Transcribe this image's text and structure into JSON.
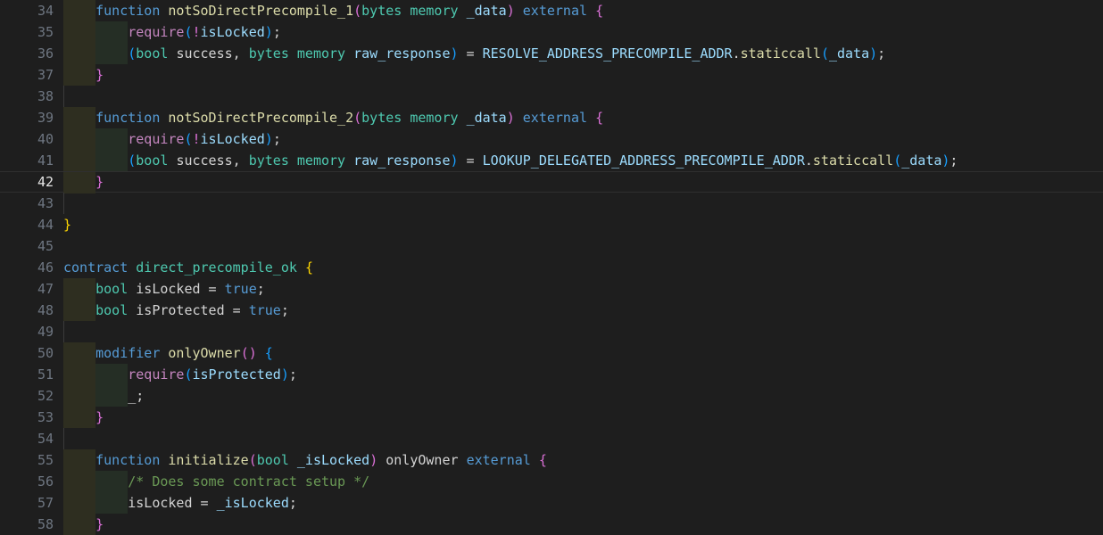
{
  "editor": {
    "language": "solidity",
    "active_line": 42,
    "first_line": 34,
    "last_line": 58,
    "colors": {
      "background": "#1e1e1e",
      "gutter_text": "#6e7681",
      "gutter_active_text": "#e6e6e6",
      "active_line_border": "#2f2f2f",
      "indent_olive": "#2e2e20",
      "indent_green": "#252e25",
      "indent_guide": "#3b3b3b",
      "keyword": "#569cd6",
      "type": "#4ec9b0",
      "function_name": "#dcdcaa",
      "variable": "#9cdcfe",
      "punctuation": "#d4d4d4",
      "comment": "#6a9955",
      "require_keyword": "#c586c0",
      "bracket_level_1": "#ffd700",
      "bracket_level_2": "#da70d6",
      "bracket_level_3": "#179fff"
    }
  },
  "lines": [
    {
      "number": "34",
      "indents": [
        {
          "level": 1,
          "style": "olive"
        }
      ],
      "tokens": [
        {
          "t": "    ",
          "c": "plain"
        },
        {
          "t": "function",
          "c": "kw"
        },
        {
          "t": " ",
          "c": "plain"
        },
        {
          "t": "notSoDirectPrecompile_1",
          "c": "fn"
        },
        {
          "t": "(",
          "c": "b2"
        },
        {
          "t": "bytes",
          "c": "typ"
        },
        {
          "t": " ",
          "c": "plain"
        },
        {
          "t": "memory",
          "c": "typ"
        },
        {
          "t": " ",
          "c": "plain"
        },
        {
          "t": "_data",
          "c": "var"
        },
        {
          "t": ")",
          "c": "b2"
        },
        {
          "t": " ",
          "c": "plain"
        },
        {
          "t": "external",
          "c": "kw"
        },
        {
          "t": " ",
          "c": "plain"
        },
        {
          "t": "{",
          "c": "b2"
        }
      ]
    },
    {
      "number": "35",
      "indents": [
        {
          "level": 1,
          "style": "olive"
        },
        {
          "level": 2,
          "style": "green"
        }
      ],
      "tokens": [
        {
          "t": "        ",
          "c": "plain"
        },
        {
          "t": "require",
          "c": "req"
        },
        {
          "t": "(",
          "c": "b3"
        },
        {
          "t": "!",
          "c": "b2"
        },
        {
          "t": "isLocked",
          "c": "var"
        },
        {
          "t": ")",
          "c": "b3"
        },
        {
          "t": ";",
          "c": "punc"
        }
      ]
    },
    {
      "number": "36",
      "indents": [
        {
          "level": 1,
          "style": "olive"
        },
        {
          "level": 2,
          "style": "green"
        }
      ],
      "tokens": [
        {
          "t": "        ",
          "c": "plain"
        },
        {
          "t": "(",
          "c": "b3"
        },
        {
          "t": "bool",
          "c": "typ"
        },
        {
          "t": " ",
          "c": "plain"
        },
        {
          "t": "success",
          "c": "plain"
        },
        {
          "t": ", ",
          "c": "punc"
        },
        {
          "t": "bytes",
          "c": "typ"
        },
        {
          "t": " ",
          "c": "plain"
        },
        {
          "t": "memory",
          "c": "typ"
        },
        {
          "t": " ",
          "c": "plain"
        },
        {
          "t": "raw_response",
          "c": "var"
        },
        {
          "t": ")",
          "c": "b3"
        },
        {
          "t": " = ",
          "c": "punc"
        },
        {
          "t": "RESOLVE_ADDRESS_PRECOMPILE_ADDR",
          "c": "var"
        },
        {
          "t": ".",
          "c": "punc"
        },
        {
          "t": "staticcall",
          "c": "fn"
        },
        {
          "t": "(",
          "c": "b3"
        },
        {
          "t": "_data",
          "c": "var"
        },
        {
          "t": ")",
          "c": "b3"
        },
        {
          "t": ";",
          "c": "punc"
        }
      ]
    },
    {
      "number": "37",
      "indents": [
        {
          "level": 1,
          "style": "olive"
        }
      ],
      "tokens": [
        {
          "t": "    ",
          "c": "plain"
        },
        {
          "t": "}",
          "c": "b2"
        }
      ]
    },
    {
      "number": "38",
      "indents": [
        {
          "level": 1,
          "style": "line"
        }
      ],
      "tokens": []
    },
    {
      "number": "39",
      "indents": [
        {
          "level": 1,
          "style": "olive"
        }
      ],
      "tokens": [
        {
          "t": "    ",
          "c": "plain"
        },
        {
          "t": "function",
          "c": "kw"
        },
        {
          "t": " ",
          "c": "plain"
        },
        {
          "t": "notSoDirectPrecompile_2",
          "c": "fn"
        },
        {
          "t": "(",
          "c": "b2"
        },
        {
          "t": "bytes",
          "c": "typ"
        },
        {
          "t": " ",
          "c": "plain"
        },
        {
          "t": "memory",
          "c": "typ"
        },
        {
          "t": " ",
          "c": "plain"
        },
        {
          "t": "_data",
          "c": "var"
        },
        {
          "t": ")",
          "c": "b2"
        },
        {
          "t": " ",
          "c": "plain"
        },
        {
          "t": "external",
          "c": "kw"
        },
        {
          "t": " ",
          "c": "plain"
        },
        {
          "t": "{",
          "c": "b2"
        }
      ]
    },
    {
      "number": "40",
      "indents": [
        {
          "level": 1,
          "style": "olive"
        },
        {
          "level": 2,
          "style": "green"
        }
      ],
      "tokens": [
        {
          "t": "        ",
          "c": "plain"
        },
        {
          "t": "require",
          "c": "req"
        },
        {
          "t": "(",
          "c": "b3"
        },
        {
          "t": "!",
          "c": "b2"
        },
        {
          "t": "isLocked",
          "c": "var"
        },
        {
          "t": ")",
          "c": "b3"
        },
        {
          "t": ";",
          "c": "punc"
        }
      ]
    },
    {
      "number": "41",
      "indents": [
        {
          "level": 1,
          "style": "olive"
        },
        {
          "level": 2,
          "style": "green"
        }
      ],
      "tokens": [
        {
          "t": "        ",
          "c": "plain"
        },
        {
          "t": "(",
          "c": "b3"
        },
        {
          "t": "bool",
          "c": "typ"
        },
        {
          "t": " ",
          "c": "plain"
        },
        {
          "t": "success",
          "c": "plain"
        },
        {
          "t": ", ",
          "c": "punc"
        },
        {
          "t": "bytes",
          "c": "typ"
        },
        {
          "t": " ",
          "c": "plain"
        },
        {
          "t": "memory",
          "c": "typ"
        },
        {
          "t": " ",
          "c": "plain"
        },
        {
          "t": "raw_response",
          "c": "var"
        },
        {
          "t": ")",
          "c": "b3"
        },
        {
          "t": " = ",
          "c": "punc"
        },
        {
          "t": "LOOKUP_DELEGATED_ADDRESS_PRECOMPILE_ADDR",
          "c": "var"
        },
        {
          "t": ".",
          "c": "punc"
        },
        {
          "t": "staticcall",
          "c": "fn"
        },
        {
          "t": "(",
          "c": "b3"
        },
        {
          "t": "_data",
          "c": "var"
        },
        {
          "t": ")",
          "c": "b3"
        },
        {
          "t": ";",
          "c": "punc"
        }
      ]
    },
    {
      "number": "42",
      "active": true,
      "indents": [
        {
          "level": 1,
          "style": "olive"
        }
      ],
      "tokens": [
        {
          "t": "    ",
          "c": "plain"
        },
        {
          "t": "}",
          "c": "b2"
        }
      ]
    },
    {
      "number": "43",
      "indents": [
        {
          "level": 1,
          "style": "line"
        }
      ],
      "tokens": []
    },
    {
      "number": "44",
      "indents": [],
      "tokens": [
        {
          "t": "}",
          "c": "b1"
        }
      ]
    },
    {
      "number": "45",
      "indents": [],
      "tokens": []
    },
    {
      "number": "46",
      "indents": [],
      "tokens": [
        {
          "t": "contract",
          "c": "kw"
        },
        {
          "t": " ",
          "c": "plain"
        },
        {
          "t": "direct_precompile_ok",
          "c": "typ"
        },
        {
          "t": " ",
          "c": "plain"
        },
        {
          "t": "{",
          "c": "b1"
        }
      ]
    },
    {
      "number": "47",
      "indents": [
        {
          "level": 1,
          "style": "olive"
        }
      ],
      "tokens": [
        {
          "t": "    ",
          "c": "plain"
        },
        {
          "t": "bool",
          "c": "typ"
        },
        {
          "t": " ",
          "c": "plain"
        },
        {
          "t": "isLocked",
          "c": "plain"
        },
        {
          "t": " = ",
          "c": "punc"
        },
        {
          "t": "true",
          "c": "kw"
        },
        {
          "t": ";",
          "c": "punc"
        }
      ]
    },
    {
      "number": "48",
      "indents": [
        {
          "level": 1,
          "style": "olive"
        }
      ],
      "tokens": [
        {
          "t": "    ",
          "c": "plain"
        },
        {
          "t": "bool",
          "c": "typ"
        },
        {
          "t": " ",
          "c": "plain"
        },
        {
          "t": "isProtected",
          "c": "plain"
        },
        {
          "t": " = ",
          "c": "punc"
        },
        {
          "t": "true",
          "c": "kw"
        },
        {
          "t": ";",
          "c": "punc"
        }
      ]
    },
    {
      "number": "49",
      "indents": [
        {
          "level": 1,
          "style": "line"
        }
      ],
      "tokens": []
    },
    {
      "number": "50",
      "indents": [
        {
          "level": 1,
          "style": "olive"
        }
      ],
      "tokens": [
        {
          "t": "    ",
          "c": "plain"
        },
        {
          "t": "modifier",
          "c": "kw"
        },
        {
          "t": " ",
          "c": "plain"
        },
        {
          "t": "onlyOwner",
          "c": "fn"
        },
        {
          "t": "()",
          "c": "b2"
        },
        {
          "t": " ",
          "c": "plain"
        },
        {
          "t": "{",
          "c": "b3"
        }
      ]
    },
    {
      "number": "51",
      "indents": [
        {
          "level": 1,
          "style": "olive"
        },
        {
          "level": 2,
          "style": "green"
        }
      ],
      "tokens": [
        {
          "t": "        ",
          "c": "plain"
        },
        {
          "t": "require",
          "c": "req"
        },
        {
          "t": "(",
          "c": "b3"
        },
        {
          "t": "isProtected",
          "c": "var"
        },
        {
          "t": ")",
          "c": "b3"
        },
        {
          "t": ";",
          "c": "punc"
        }
      ]
    },
    {
      "number": "52",
      "indents": [
        {
          "level": 1,
          "style": "olive"
        },
        {
          "level": 2,
          "style": "green"
        }
      ],
      "tokens": [
        {
          "t": "        ",
          "c": "plain"
        },
        {
          "t": "_;",
          "c": "plain"
        }
      ]
    },
    {
      "number": "53",
      "indents": [
        {
          "level": 1,
          "style": "olive"
        }
      ],
      "tokens": [
        {
          "t": "    ",
          "c": "plain"
        },
        {
          "t": "}",
          "c": "b2"
        }
      ]
    },
    {
      "number": "54",
      "indents": [
        {
          "level": 1,
          "style": "line"
        }
      ],
      "tokens": []
    },
    {
      "number": "55",
      "indents": [
        {
          "level": 1,
          "style": "olive"
        }
      ],
      "tokens": [
        {
          "t": "    ",
          "c": "plain"
        },
        {
          "t": "function",
          "c": "kw"
        },
        {
          "t": " ",
          "c": "plain"
        },
        {
          "t": "initialize",
          "c": "fn"
        },
        {
          "t": "(",
          "c": "b2"
        },
        {
          "t": "bool",
          "c": "typ"
        },
        {
          "t": " ",
          "c": "plain"
        },
        {
          "t": "_isLocked",
          "c": "var"
        },
        {
          "t": ")",
          "c": "b2"
        },
        {
          "t": " ",
          "c": "plain"
        },
        {
          "t": "onlyOwner",
          "c": "plain"
        },
        {
          "t": " ",
          "c": "plain"
        },
        {
          "t": "external",
          "c": "kw"
        },
        {
          "t": " ",
          "c": "plain"
        },
        {
          "t": "{",
          "c": "b2"
        }
      ]
    },
    {
      "number": "56",
      "indents": [
        {
          "level": 1,
          "style": "olive"
        },
        {
          "level": 2,
          "style": "green"
        }
      ],
      "tokens": [
        {
          "t": "        ",
          "c": "plain"
        },
        {
          "t": "/* Does some contract setup */",
          "c": "cmt"
        }
      ]
    },
    {
      "number": "57",
      "indents": [
        {
          "level": 1,
          "style": "olive"
        },
        {
          "level": 2,
          "style": "green"
        }
      ],
      "tokens": [
        {
          "t": "        ",
          "c": "plain"
        },
        {
          "t": "isLocked",
          "c": "plain"
        },
        {
          "t": " = ",
          "c": "punc"
        },
        {
          "t": "_isLocked",
          "c": "var"
        },
        {
          "t": ";",
          "c": "punc"
        }
      ]
    },
    {
      "number": "58",
      "indents": [
        {
          "level": 1,
          "style": "olive"
        }
      ],
      "tokens": [
        {
          "t": "    ",
          "c": "plain"
        },
        {
          "t": "}",
          "c": "b2"
        }
      ]
    }
  ]
}
